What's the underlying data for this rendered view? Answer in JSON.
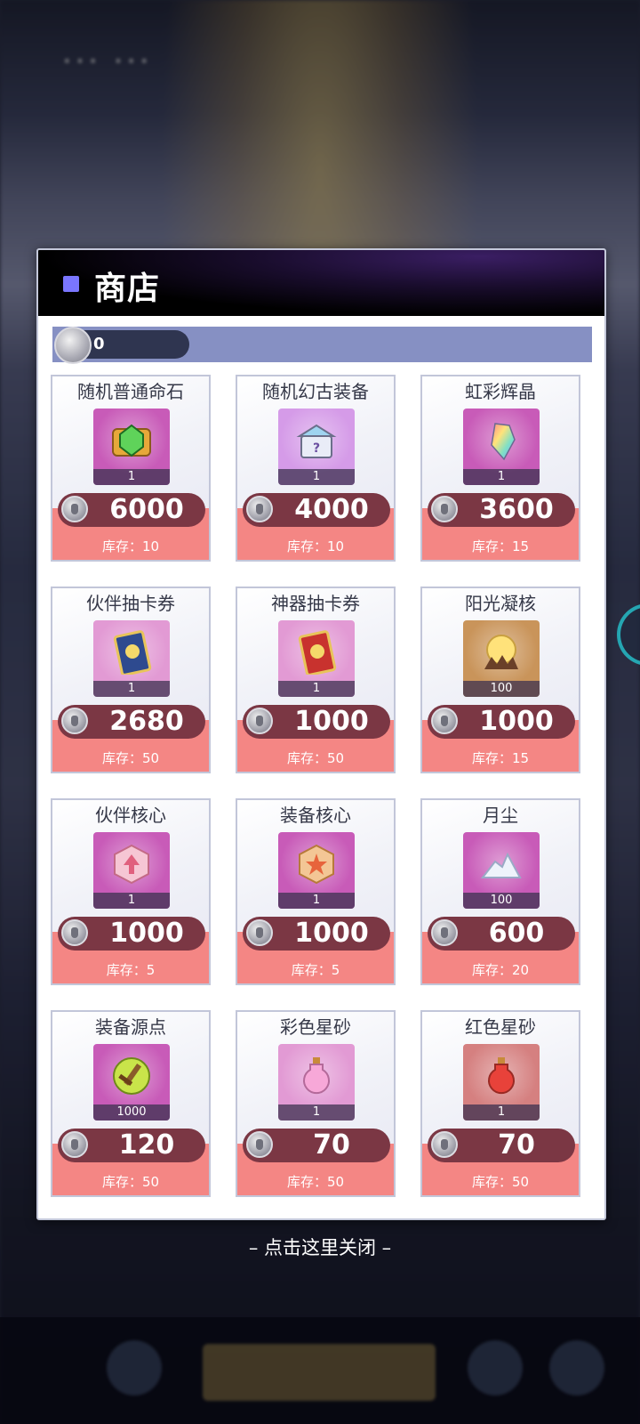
{
  "shop": {
    "title": "商店",
    "currency_amount": "0",
    "currency_icon": "silver-helmet-coin-icon",
    "close_hint": "– 点击这里关闭 –",
    "items": [
      {
        "name": "随机普通命石",
        "count": "1",
        "price": "6000",
        "stock": "库存：10",
        "icon": "green-gem-icon",
        "bg": "#c85bb8"
      },
      {
        "name": "随机幻古装备",
        "count": "1",
        "price": "4000",
        "stock": "库存：10",
        "icon": "mystery-chest-icon",
        "bg": "#d59be8"
      },
      {
        "name": "虹彩辉晶",
        "count": "1",
        "price": "3600",
        "stock": "库存：15",
        "icon": "rainbow-crystal-icon",
        "bg": "#c85bb8"
      },
      {
        "name": "伙伴抽卡券",
        "count": "1",
        "price": "2680",
        "stock": "库存：50",
        "icon": "blue-card-icon",
        "bg": "#e29ad4"
      },
      {
        "name": "神器抽卡券",
        "count": "1",
        "price": "1000",
        "stock": "库存：50",
        "icon": "red-card-icon",
        "bg": "#e29ad4"
      },
      {
        "name": "阳光凝核",
        "count": "100",
        "price": "1000",
        "stock": "库存：15",
        "icon": "sun-core-icon",
        "bg": "#c9945a"
      },
      {
        "name": "伙伴核心",
        "count": "1",
        "price": "1000",
        "stock": "库存：5",
        "icon": "pink-core-icon",
        "bg": "#c85bb8"
      },
      {
        "name": "装备核心",
        "count": "1",
        "price": "1000",
        "stock": "库存：5",
        "icon": "star-core-icon",
        "bg": "#c85bb8"
      },
      {
        "name": "月尘",
        "count": "100",
        "price": "600",
        "stock": "库存：20",
        "icon": "moon-dust-icon",
        "bg": "#c85bb8"
      },
      {
        "name": "装备源点",
        "count": "1000",
        "price": "120",
        "stock": "库存：50",
        "icon": "sword-orb-icon",
        "bg": "#c85bb8"
      },
      {
        "name": "彩色星砂",
        "count": "1",
        "price": "70",
        "stock": "库存：50",
        "icon": "color-stardust-icon",
        "bg": "#e29ad4"
      },
      {
        "name": "红色星砂",
        "count": "1",
        "price": "70",
        "stock": "库存：50",
        "icon": "red-stardust-icon",
        "bg": "#d58080"
      }
    ]
  }
}
